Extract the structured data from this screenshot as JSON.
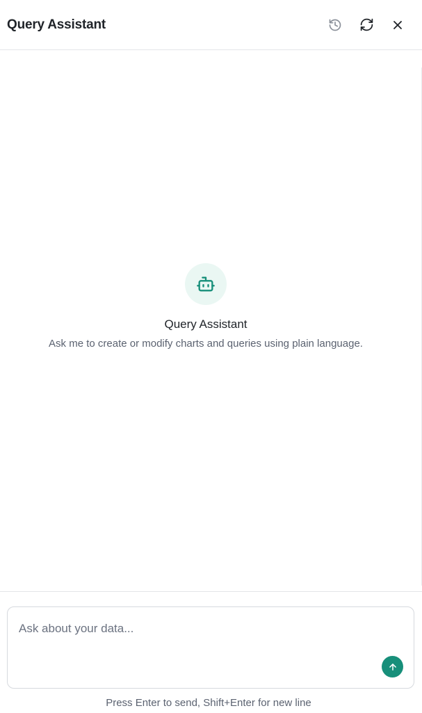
{
  "header": {
    "title": "Query Assistant",
    "actions": [
      {
        "icon": "history-icon",
        "label": "History"
      },
      {
        "icon": "refresh-icon",
        "label": "New conversation"
      },
      {
        "icon": "close-icon",
        "label": "Close"
      }
    ]
  },
  "empty_state": {
    "icon": "bot-icon",
    "title": "Query Assistant",
    "description": "Ask me to create or modify charts and queries using plain language."
  },
  "composer": {
    "placeholder": "Ask about your data...",
    "value": "",
    "send_icon": "arrow-up-icon",
    "hint": "Press Enter to send, Shift+Enter for new line"
  },
  "colors": {
    "accent": "#178f7a",
    "accent_soft": "#eaf7f3",
    "text": "#1f2328",
    "muted": "#5b6270",
    "border": "#e3e5e8"
  }
}
